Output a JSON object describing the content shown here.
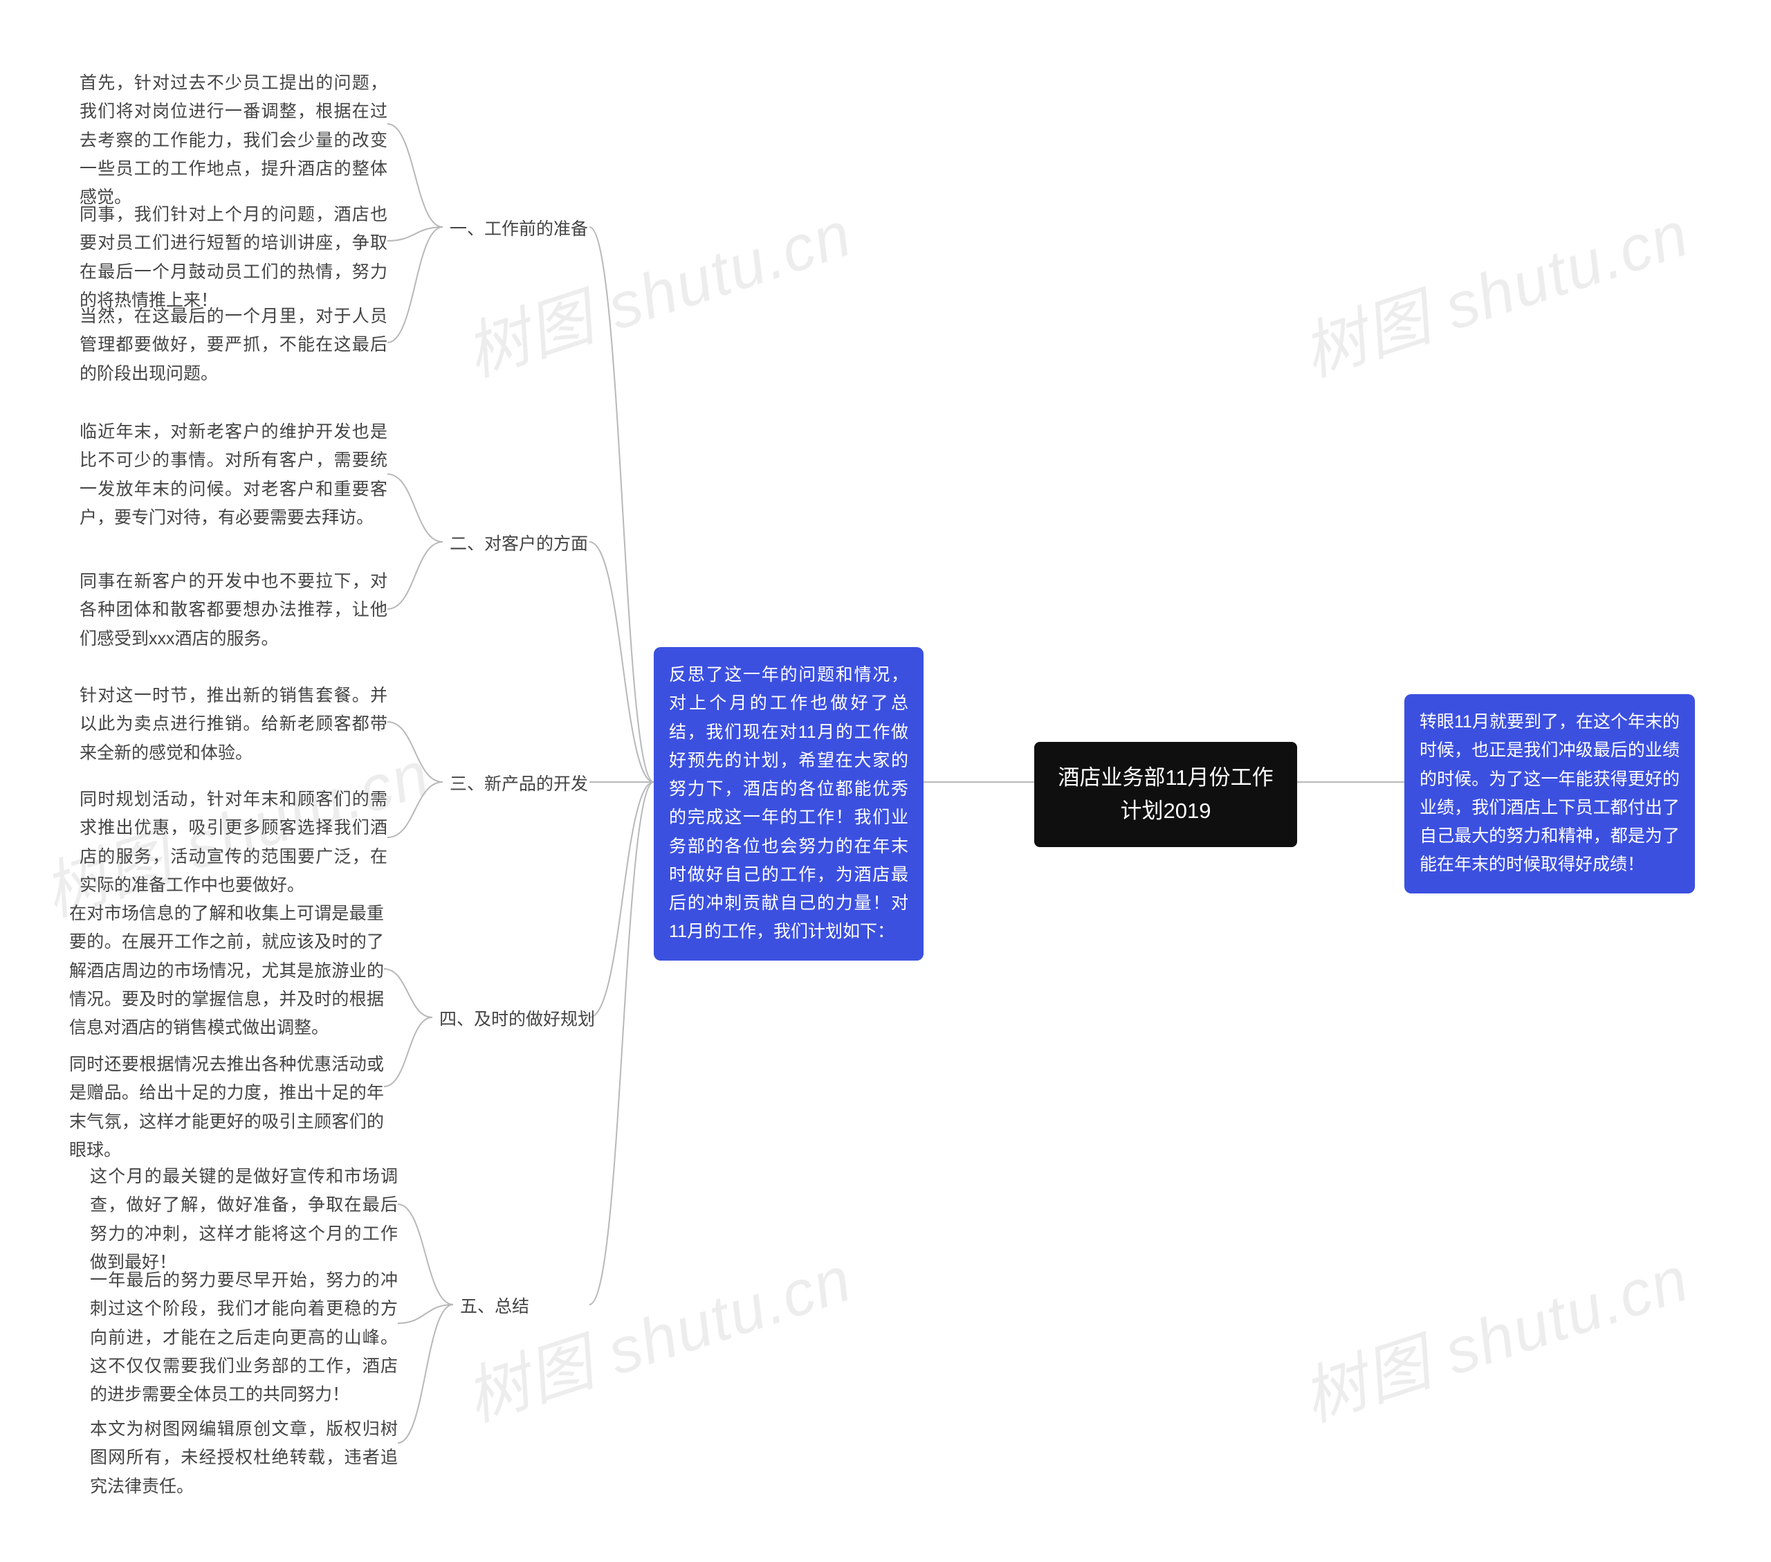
{
  "watermark": "树图 shutu.cn",
  "root": {
    "title": "酒店业务部11月份工作计划2019"
  },
  "right_blue": "转眼11月就要到了，在这个年末的时候，也正是我们冲级最后的业绩的时候。为了这一年能获得更好的业绩，我们酒店上下员工都付出了自己最大的努力和精神，都是为了能在年末的时候取得好成绩！",
  "left_blue": "反思了这一年的问题和情况，对上个月的工作也做好了总结，我们现在对11月的工作做好预先的计划，希望在大家的努力下，酒店的各位都能优秀的完成这一年的工作！我们业务部的各位也会努力的在年末时做好自己的工作，为酒店最后的冲刺贡献自己的力量！对11月的工作，我们计划如下：",
  "sections": {
    "s1": {
      "heading": "一、工作前的准备",
      "items": {
        "a": "首先，针对过去不少员工提出的问题，我们将对岗位进行一番调整，根据在过去考察的工作能力，我们会少量的改变一些员工的工作地点，提升酒店的整体感觉。",
        "b": "同事，我们针对上个月的问题，酒店也要对员工们进行短暂的培训讲座，争取在最后一个月鼓动员工们的热情，努力的将热情推上来！",
        "c": "当然，在这最后的一个月里，对于人员管理都要做好，要严抓，不能在这最后的阶段出现问题。"
      }
    },
    "s2": {
      "heading": "二、对客户的方面",
      "items": {
        "a": "临近年末，对新老客户的维护开发也是比不可少的事情。对所有客户，需要统一发放年末的问候。对老客户和重要客户，要专门对待，有必要需要去拜访。",
        "b": "同事在新客户的开发中也不要拉下，对各种团体和散客都要想办法推荐，让他们感受到xxx酒店的服务。"
      }
    },
    "s3": {
      "heading": "三、新产品的开发",
      "items": {
        "a": "针对这一时节，推出新的销售套餐。并以此为卖点进行推销。给新老顾客都带来全新的感觉和体验。",
        "b": "同时规划活动，针对年末和顾客们的需求推出优惠，吸引更多顾客选择我们酒店的服务，活动宣传的范围要广泛，在实际的准备工作中也要做好。"
      }
    },
    "s4": {
      "heading": "四、及时的做好规划",
      "items": {
        "a": "在对市场信息的了解和收集上可谓是最重要的。在展开工作之前，就应该及时的了解酒店周边的市场情况，尤其是旅游业的情况。要及时的掌握信息，并及时的根据信息对酒店的销售模式做出调整。",
        "b": "同时还要根据情况去推出各种优惠活动或是赠品。给出十足的力度，推出十足的年末气氛，这样才能更好的吸引主顾客们的眼球。"
      }
    },
    "s5": {
      "heading": "五、总结",
      "items": {
        "a": "这个月的最关键的是做好宣传和市场调查，做好了解，做好准备，争取在最后努力的冲刺，这样才能将这个月的工作做到最好！",
        "b": "一年最后的努力要尽早开始，努力的冲刺过这个阶段，我们才能向着更稳的方向前进，才能在之后走向更高的山峰。这不仅仅需要我们业务部的工作，酒店的进步需要全体员工的共同努力！",
        "c": "本文为树图网编辑原创文章，版权归树图网所有，未经授权杜绝转载，违者追究法律责任。"
      }
    }
  }
}
